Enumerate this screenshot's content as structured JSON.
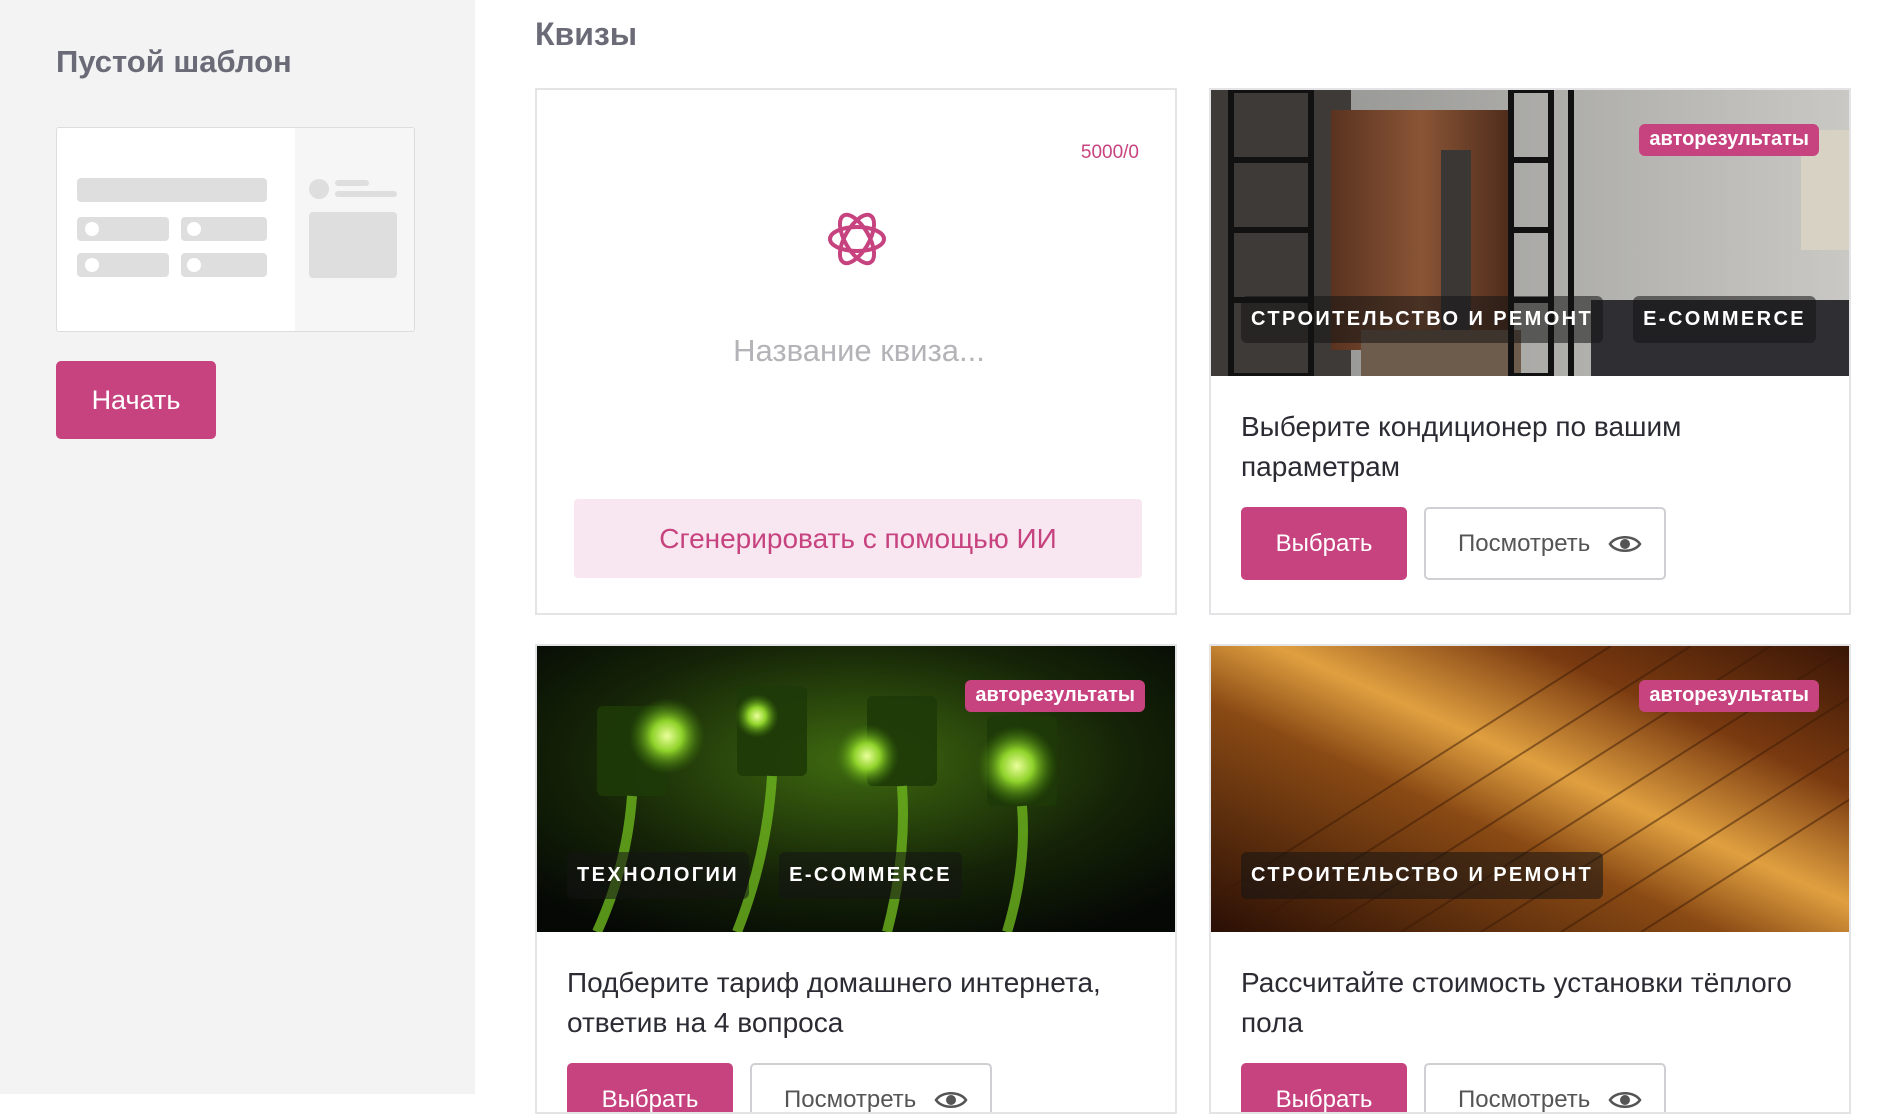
{
  "sidebar": {
    "title": "Пустой шаблон",
    "start_label": "Начать"
  },
  "main": {
    "section_title": "Квизы",
    "ai_card": {
      "counter": "5000/0",
      "input_placeholder": "Название квиза...",
      "input_value": "",
      "generate_label": "Сгенерировать с помощью ИИ",
      "icon": "openai-logo-icon"
    },
    "cards": [
      {
        "badge": "авторезультаты",
        "tags": [
          "СТРОИТЕЛЬСТВО И РЕМОНТ",
          "E-COMMERCE"
        ],
        "title": "Выберите кондиционер по вашим параметрам",
        "choose_label": "Выбрать",
        "view_label": "Посмотреть"
      },
      {
        "badge": "авторезультаты",
        "tags": [
          "ТЕХНОЛОГИИ",
          "E-COMMERCE"
        ],
        "title": "Подберите тариф домашнего интернета, ответив на 4 вопроса",
        "choose_label": "Выбрать",
        "view_label": "Посмотреть"
      },
      {
        "badge": "авторезультаты",
        "tags": [
          "СТРОИТЕЛЬСТВО И РЕМОНТ"
        ],
        "title": "Рассчитайте стоимость установки тёплого пола",
        "choose_label": "Выбрать",
        "view_label": "Посмотреть"
      }
    ]
  },
  "colors": {
    "accent": "#c7437f",
    "accent_light": "#f8e6f0",
    "sidebar_bg": "#f3f3f4",
    "heading": "#6b6b78"
  }
}
